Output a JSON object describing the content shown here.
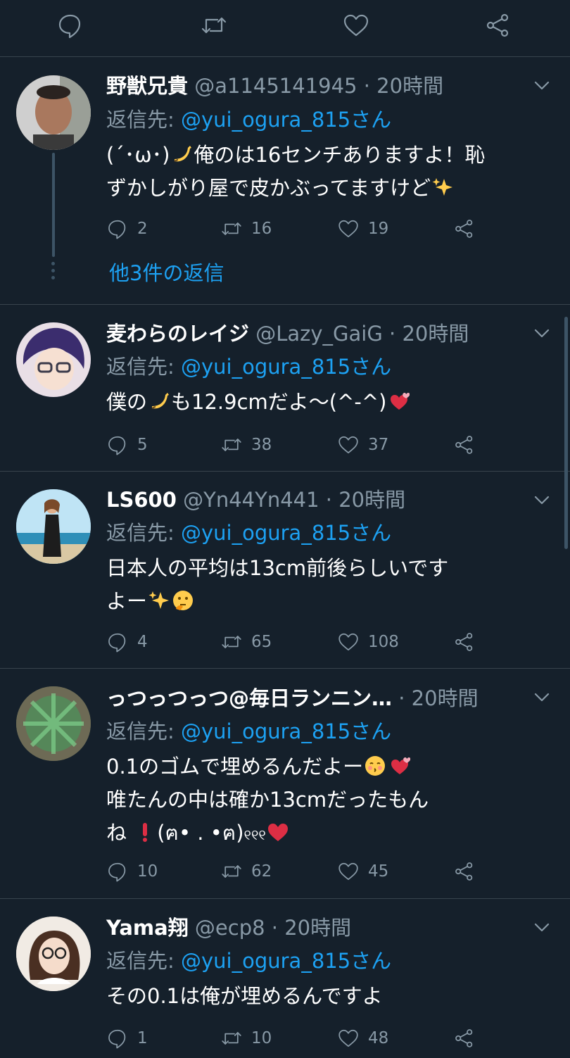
{
  "top_actions": [
    "reply-icon",
    "retweet-icon",
    "like-icon",
    "share-icon"
  ],
  "tweets": [
    {
      "name": "野獣兄貴",
      "handle": "@a1145141945 · 20時間",
      "reply_prefix": "返信先: ",
      "reply_target": "@yui_ogura_815さん",
      "body_lines": [
        "(´･ω･)",
        "俺のは16センチありますよ！恥",
        "ずかしがり屋で皮かぶってますけど"
      ],
      "replies": "2",
      "retweets": "16",
      "likes": "19",
      "more_replies": "他3件の返信",
      "avatar_color": "#8a6f5c"
    },
    {
      "name": "麦わらのレイジ",
      "handle": "@Lazy_GaiG · 20時間",
      "reply_prefix": "返信先: ",
      "reply_target": "@yui_ogura_815さん",
      "body_lines": [
        "僕の",
        "も12.9cmだよ〜(^-^)"
      ],
      "replies": "5",
      "retweets": "38",
      "likes": "37",
      "avatar_color": "#4a3c7a"
    },
    {
      "name": "LS600",
      "handle": "@Yn44Yn441 · 20時間",
      "reply_prefix": "返信先: ",
      "reply_target": "@yui_ogura_815さん",
      "body_lines": [
        "日本人の平均は13cm前後らしいです",
        "よー"
      ],
      "replies": "4",
      "retweets": "65",
      "likes": "108",
      "avatar_color": "#6fb3d9"
    },
    {
      "name": "っつっつっつ@毎日ランニン…",
      "handle": "· 20時間",
      "reply_prefix": "返信先: ",
      "reply_target": "@yui_ogura_815さん",
      "body_lines": [
        "0.1のゴムで埋めるんだよー",
        "唯たんの中は確か13cmだったもん",
        "ね",
        "(ฅ• . •ฅ)"
      ],
      "replies": "10",
      "retweets": "62",
      "likes": "45",
      "avatar_color": "#5b6b4e"
    },
    {
      "name": "Yama翔",
      "handle": "@ecp8 · 20時間",
      "reply_prefix": "返信先: ",
      "reply_target": "@yui_ogura_815さん",
      "body_lines": [
        "その0.1は俺が埋めるんですよ"
      ],
      "replies": "1",
      "retweets": "10",
      "likes": "48",
      "avatar_color": "#e8dcd0"
    }
  ]
}
